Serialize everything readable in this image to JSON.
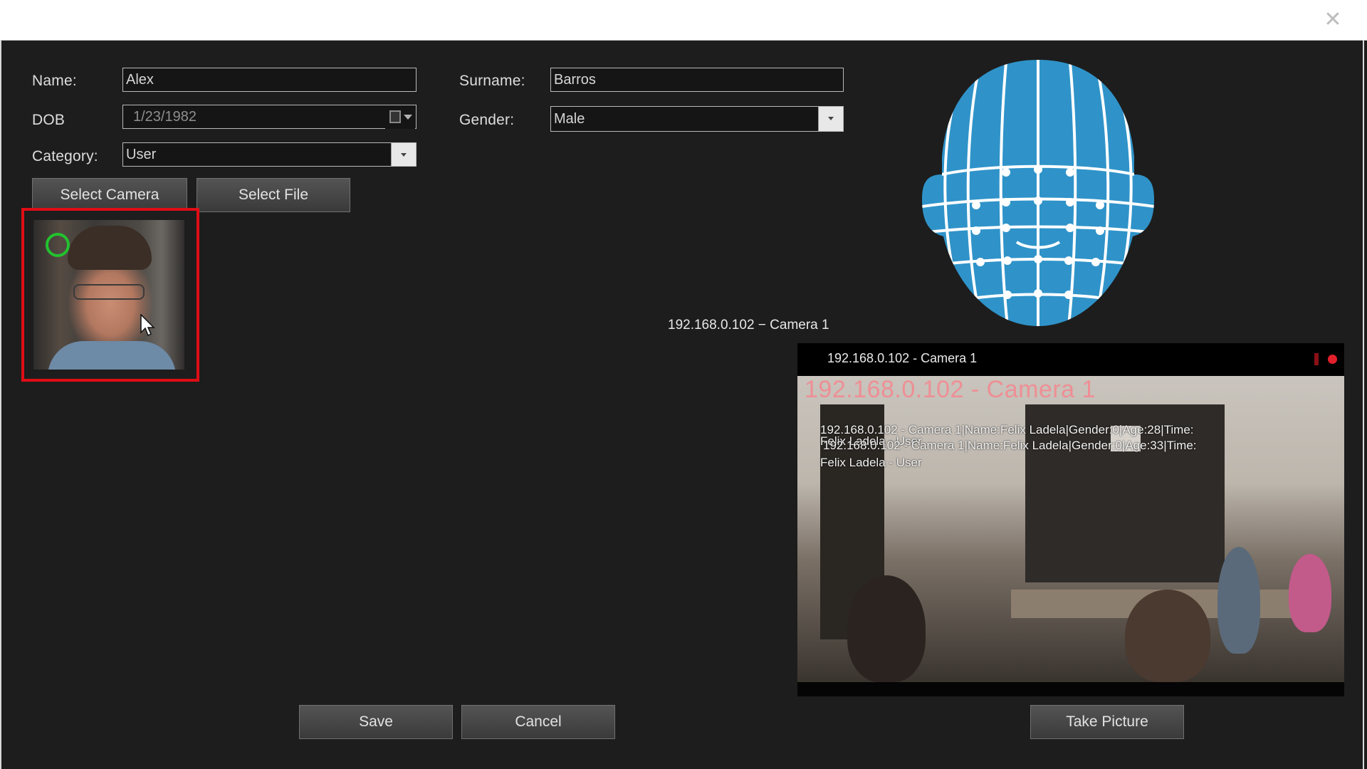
{
  "window": {
    "close_glyph": "✕"
  },
  "form": {
    "name_label": "Name:",
    "name_value": "Alex",
    "surname_label": "Surname:",
    "surname_value": "Barros",
    "dob_label": "DOB",
    "dob_value": "1/23/1982",
    "gender_label": "Gender:",
    "gender_value": "Male",
    "category_label": "Category:",
    "category_value": "User"
  },
  "buttons": {
    "select_camera": "Select Camera",
    "select_file": "Select File",
    "save": "Save",
    "cancel": "Cancel",
    "take_picture": "Take Picture"
  },
  "camera": {
    "caption": "192.168.0.102 − Camera 1",
    "window_title": "192.168.0.102 - Camera 1",
    "overlay_title": "192.168.0.102 - Camera 1",
    "overlay_lines": [
      "192.168.0.102 - Camera 1|Name:Felix Ladela|Gender:0|Age:28|Time:",
      "Felix Ladela - User",
      "192.168.0.102 - Camera 1|Name:Felix Ladela|Gender:0|Age:33|Time:",
      "Felix Ladela - User"
    ]
  },
  "colors": {
    "accent_red": "#e00d15",
    "detect_green": "#22c22e",
    "head_blue": "#2f93c9"
  },
  "icons": {
    "close": "close-icon",
    "calendar": "calendar-icon",
    "dropdown": "chevron-down-icon",
    "record": "record-icon",
    "cursor": "mouse-cursor-icon"
  }
}
